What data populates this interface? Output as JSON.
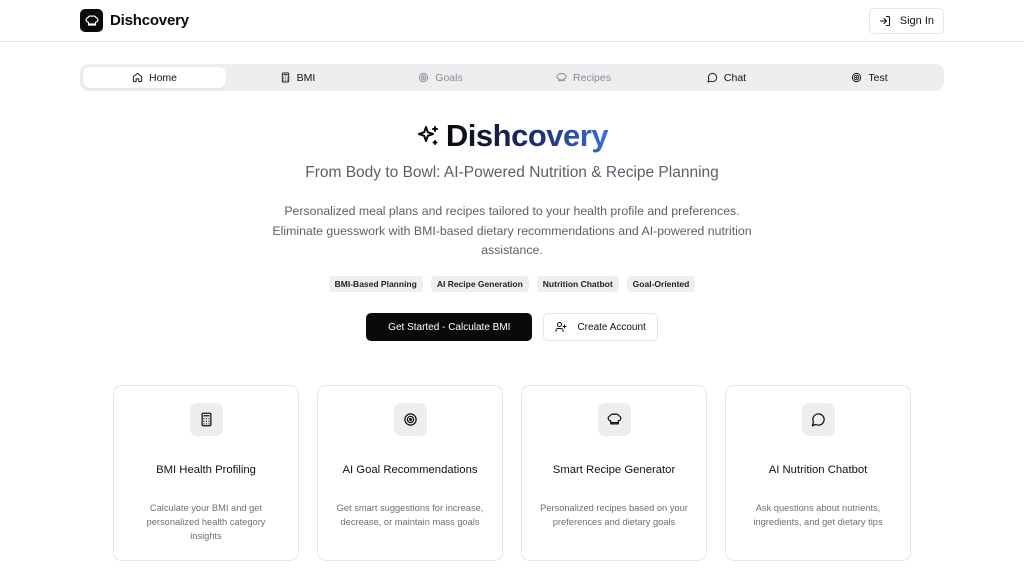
{
  "header": {
    "brand": "Dishcovery",
    "signin_label": "Sign In"
  },
  "nav": {
    "tabs": [
      {
        "label": "Home",
        "icon": "home-icon",
        "state": "active"
      },
      {
        "label": "BMI",
        "icon": "calculator-icon",
        "state": "enabled"
      },
      {
        "label": "Goals",
        "icon": "target-icon",
        "state": "muted"
      },
      {
        "label": "Recipes",
        "icon": "chef-hat-icon",
        "state": "muted"
      },
      {
        "label": "Chat",
        "icon": "chat-bubble-icon",
        "state": "enabled"
      },
      {
        "label": "Test",
        "icon": "target-icon",
        "state": "enabled"
      }
    ]
  },
  "hero": {
    "title": "Dishcovery",
    "subtitle": "From Body to Bowl: AI-Powered Nutrition & Recipe Planning",
    "description": "Personalized meal plans and recipes tailored to your health profile and preferences. Eliminate guesswork with BMI-based dietary recommendations and AI-powered nutrition assistance.",
    "badges": [
      "BMI-Based Planning",
      "AI Recipe Generation",
      "Nutrition Chatbot",
      "Goal-Oriented"
    ],
    "primary_cta": "Get Started - Calculate BMI",
    "secondary_cta": "Create Account"
  },
  "features": [
    {
      "icon": "calculator-icon",
      "title": "BMI Health Profiling",
      "description": "Calculate your BMI and get personalized health category insights"
    },
    {
      "icon": "target-icon",
      "title": "AI Goal Recommendations",
      "description": "Get smart suggestions for increase, decrease, or maintain mass goals"
    },
    {
      "icon": "chef-hat-icon",
      "title": "Smart Recipe Generator",
      "description": "Personalized recipes based on your preferences and dietary goals"
    },
    {
      "icon": "chat-bubble-icon",
      "title": "AI Nutrition Chatbot",
      "description": "Ask questions about nutrients, ingredients, and get dietary tips"
    }
  ],
  "colors": {
    "primary": "#0a0a0a",
    "muted_bg": "#eeeef1",
    "border": "#e5e7eb",
    "text_muted": "#5b5f6a",
    "gradient_end": "#3b6fd8"
  }
}
